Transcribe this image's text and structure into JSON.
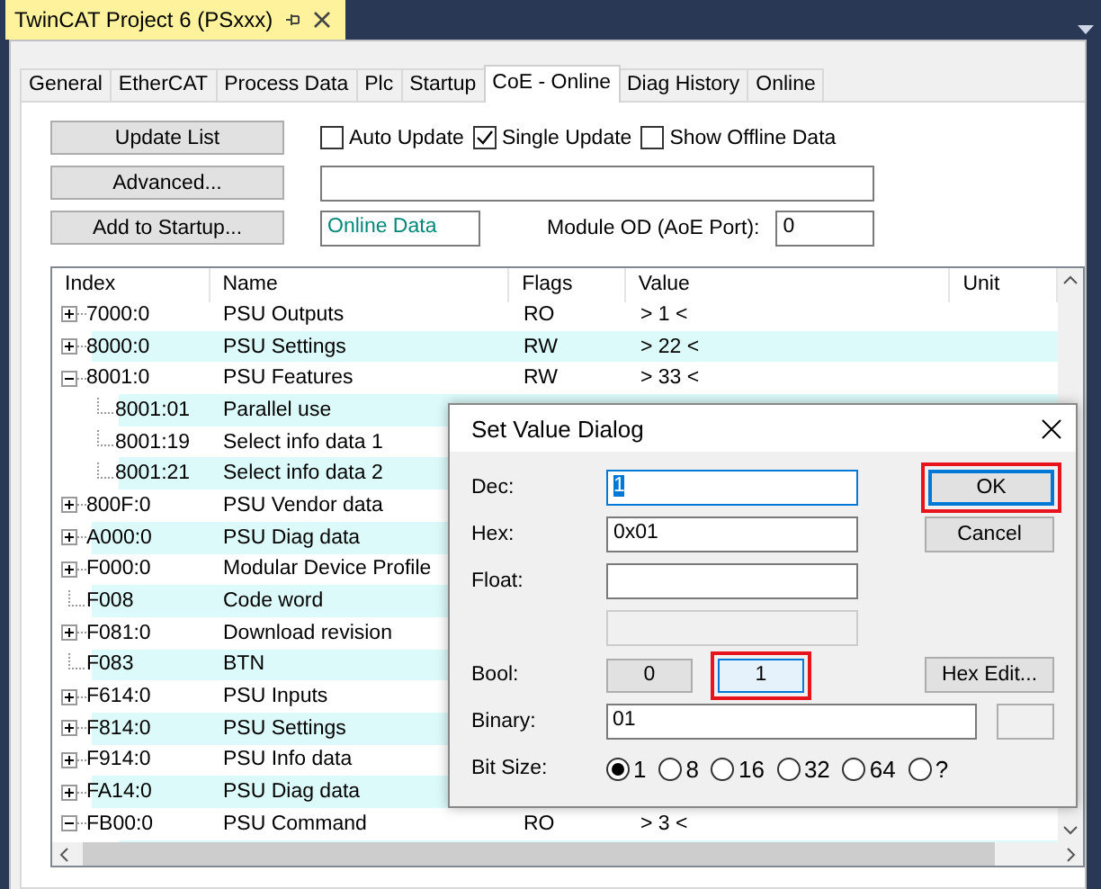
{
  "document_tab": {
    "title": "TwinCAT Project 6 (PSxxx)"
  },
  "tabs": [
    {
      "label": "General",
      "selected": false
    },
    {
      "label": "EtherCAT",
      "selected": false
    },
    {
      "label": "Process Data",
      "selected": false
    },
    {
      "label": "Plc",
      "selected": false
    },
    {
      "label": "Startup",
      "selected": false
    },
    {
      "label": "CoE - Online",
      "selected": true
    },
    {
      "label": "Diag History",
      "selected": false
    },
    {
      "label": "Online",
      "selected": false
    }
  ],
  "buttons": [
    "Update List",
    "Advanced...",
    "Add to Startup..."
  ],
  "checkboxes": [
    {
      "label": "Auto Update",
      "checked": false
    },
    {
      "label": "Single Update",
      "checked": true
    },
    {
      "label": "Show Offline Data",
      "checked": false
    }
  ],
  "status_field": {
    "value": "Online Data"
  },
  "module_od": {
    "label": "Module OD (AoE Port):",
    "value": "0"
  },
  "table": {
    "columns": [
      "Index",
      "Name",
      "Flags",
      "Value",
      "Unit"
    ],
    "rows": [
      {
        "index": "7000:0",
        "name": "PSU Outputs",
        "flags": "RO",
        "value": "> 1 <",
        "expanded": false
      },
      {
        "index": "8000:0",
        "name": "PSU Settings",
        "flags": "RW",
        "value": "> 22 <",
        "expanded": false
      },
      {
        "index": "8001:0",
        "name": "PSU Features",
        "flags": "RW",
        "value": "> 33 <",
        "expanded": true,
        "children": [
          {
            "index": "8001:01",
            "name": "Parallel use"
          },
          {
            "index": "8001:19",
            "name": "Select info data 1"
          },
          {
            "index": "8001:21",
            "name": "Select info data 2"
          }
        ]
      },
      {
        "index": "800F:0",
        "name": "PSU Vendor data",
        "expanded": false
      },
      {
        "index": "A000:0",
        "name": "PSU Diag data",
        "expanded": false
      },
      {
        "index": "F000:0",
        "name": "Modular Device Profile",
        "expanded": false
      },
      {
        "index": "F008",
        "name": "Code word"
      },
      {
        "index": "F081:0",
        "name": "Download revision",
        "expanded": false
      },
      {
        "index": "F083",
        "name": "BTN"
      },
      {
        "index": "F614:0",
        "name": "PSU Inputs",
        "expanded": false
      },
      {
        "index": "F814:0",
        "name": "PSU Settings",
        "expanded": false
      },
      {
        "index": "F914:0",
        "name": "PSU Info data",
        "expanded": false
      },
      {
        "index": "FA14:0",
        "name": "PSU Diag data",
        "expanded": false
      },
      {
        "index": "FB00:0",
        "name": "PSU Command",
        "flags": "RO",
        "value": "> 3 <",
        "expanded": true
      }
    ]
  },
  "dialog": {
    "title": "Set Value Dialog",
    "dec": {
      "label": "Dec:",
      "value": "1",
      "value_selected": true
    },
    "hex": {
      "label": "Hex:",
      "value": "0x01"
    },
    "float": {
      "label": "Float:"
    },
    "bool": {
      "label": "Bool:",
      "options": [
        {
          "label": "0",
          "selected": false,
          "highlighted": false
        },
        {
          "label": "1",
          "selected": true,
          "highlighted": true
        }
      ]
    },
    "binary": {
      "label": "Binary:",
      "value": "01"
    },
    "bit_size": {
      "label": "Bit Size:",
      "options": [
        {
          "label": "1",
          "selected": true
        },
        {
          "label": "8",
          "selected": false
        },
        {
          "label": "16",
          "selected": false
        },
        {
          "label": "32",
          "selected": false
        },
        {
          "label": "64",
          "selected": false
        },
        {
          "label": "?",
          "selected": false
        }
      ]
    },
    "ok": {
      "label": "OK",
      "highlighted": true
    },
    "cancel": {
      "label": "Cancel"
    },
    "hex_edit": {
      "label": "Hex Edit..."
    }
  }
}
